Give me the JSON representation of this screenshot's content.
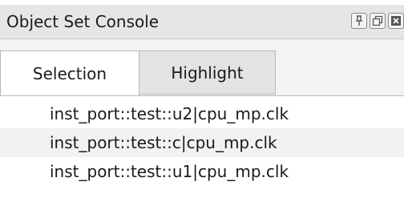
{
  "panel": {
    "title": "Object Set Console",
    "buttons": [
      {
        "icon": "pin-icon"
      },
      {
        "icon": "float-icon"
      },
      {
        "icon": "close-icon"
      }
    ]
  },
  "tabs": [
    {
      "label": "Selection",
      "active": true
    },
    {
      "label": "Highlight",
      "active": false
    }
  ],
  "list": {
    "items": [
      "inst_port::test::u2|cpu_mp.clk",
      "inst_port::test::c|cpu_mp.clk",
      "inst_port::test::u1|cpu_mp.clk"
    ]
  }
}
